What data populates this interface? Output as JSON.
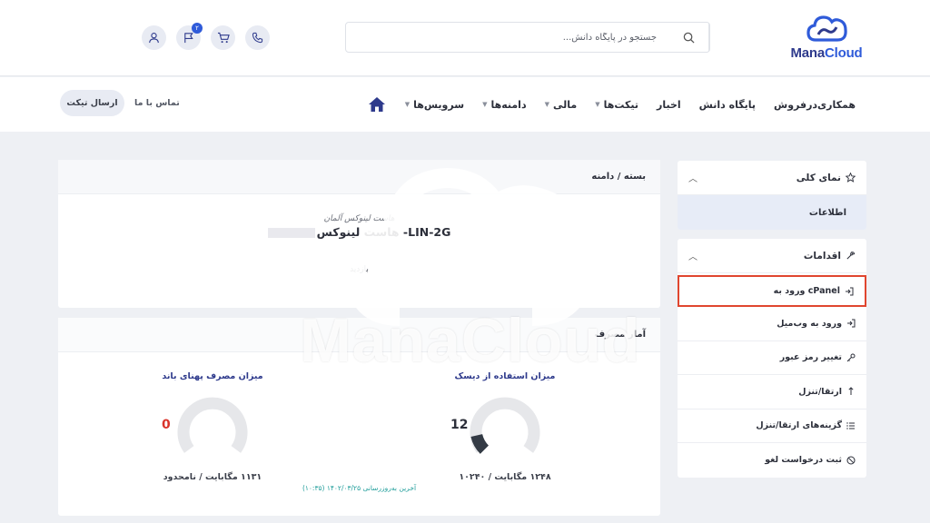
{
  "brand": {
    "part1": "Mana",
    "part2": "Cloud"
  },
  "search": {
    "placeholder": "جستجو در پایگاه دانش..."
  },
  "top_icons": {
    "cart_badge": "۲"
  },
  "nav": {
    "items": [
      {
        "label": "سرویس‌ها",
        "dropdown": true
      },
      {
        "label": "دامنه‌ها",
        "dropdown": true
      },
      {
        "label": "مالی",
        "dropdown": true
      },
      {
        "label": "تیکت‌ها",
        "dropdown": true
      },
      {
        "label": "اخبار",
        "dropdown": false
      },
      {
        "label": "پایگاه دانش",
        "dropdown": false
      },
      {
        "label": "همکاری‌درفروش",
        "dropdown": false
      }
    ],
    "contact_label": "تماس با ما",
    "send_ticket_label": "ارسال تیکت"
  },
  "sidebar": {
    "overview": {
      "title": "نمای کلی",
      "active_item": "اطلاعات"
    },
    "actions": {
      "title": "اقدامات",
      "items": [
        {
          "label": "ورود به cPanel",
          "icon": "login-icon"
        },
        {
          "label": "ورود به وب‌میل",
          "icon": "login-icon"
        },
        {
          "label": "تغییر رمز عبور",
          "icon": "key-icon"
        },
        {
          "label": "ارتقا/تنزل",
          "icon": "upgrade-icon"
        },
        {
          "label": "گزینه‌های ارتقا/تنزل",
          "icon": "list-icon"
        },
        {
          "label": "ثبت درخواست لغو",
          "icon": "cancel-icon"
        }
      ]
    }
  },
  "product": {
    "header": "بسته / دامنه",
    "group": "هاست لینوکس آلمان",
    "name": "هاست لینوکس -LIN-2G",
    "status": "بازدید"
  },
  "usage": {
    "header": "آمار مصرف",
    "disk": {
      "title": "میزان استفاده از دیسک",
      "percent": 12,
      "caption": "۱۲۴۸ مگابایت / ۱۰۲۴۰"
    },
    "bandwidth": {
      "title": "میزان مصرف پهنای باند",
      "percent": 0,
      "caption": "۱۱۳۱ مگابایت / نامحدود"
    },
    "last_update": "آخرین به‌روزرسانی ۱۴۰۲/۰۳/۲۵ (۱۰:۳۵)"
  },
  "colors": {
    "brand_blue": "#2f5bd9",
    "brand_dark": "#2e3a8c",
    "highlight": "#e0462f",
    "zero_red": "#d9342b"
  },
  "watermark": {
    "text": "ManaCloud"
  }
}
